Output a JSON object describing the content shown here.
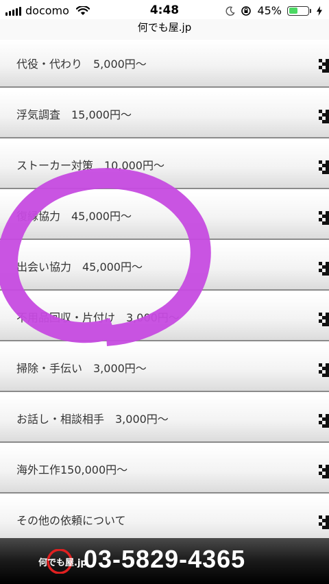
{
  "status_bar": {
    "carrier": "docomo",
    "time": "4:48",
    "battery_percent": "45%",
    "battery_level": 0.45,
    "signal_icon": "signal-bars-icon",
    "wifi_icon": "wifi-icon",
    "moon_icon": "do-not-disturb-moon-icon",
    "lock_icon": "orientation-lock-icon",
    "charging_icon": "charging-bolt-icon"
  },
  "browser": {
    "url": "何でも屋.jp"
  },
  "menu": {
    "items": [
      {
        "label": "代役・代わり　5,000円～"
      },
      {
        "label": "浮気調査　15,000円～"
      },
      {
        "label": "ストーカー対策　10,000円～"
      },
      {
        "label": "復縁協力　45,000円～"
      },
      {
        "label": "出会い協力　45,000円～"
      },
      {
        "label": "不用品回収・片付け　3,000円～"
      },
      {
        "label": "掃除・手伝い　3,000円～"
      },
      {
        "label": "お話し・相談相手　3,000円～"
      },
      {
        "label": "海外工作150,000円～"
      },
      {
        "label": "その他の依頼について"
      }
    ],
    "arrow_icon": "checkered-arrow-icon"
  },
  "annotation": {
    "color": "#c64be0",
    "shape": "hand-drawn ellipse around items 4-6"
  },
  "footer": {
    "logo_text": "何でも屋.jp",
    "phone": "03-5829-4365",
    "logo_ring_color": "#e02020"
  }
}
